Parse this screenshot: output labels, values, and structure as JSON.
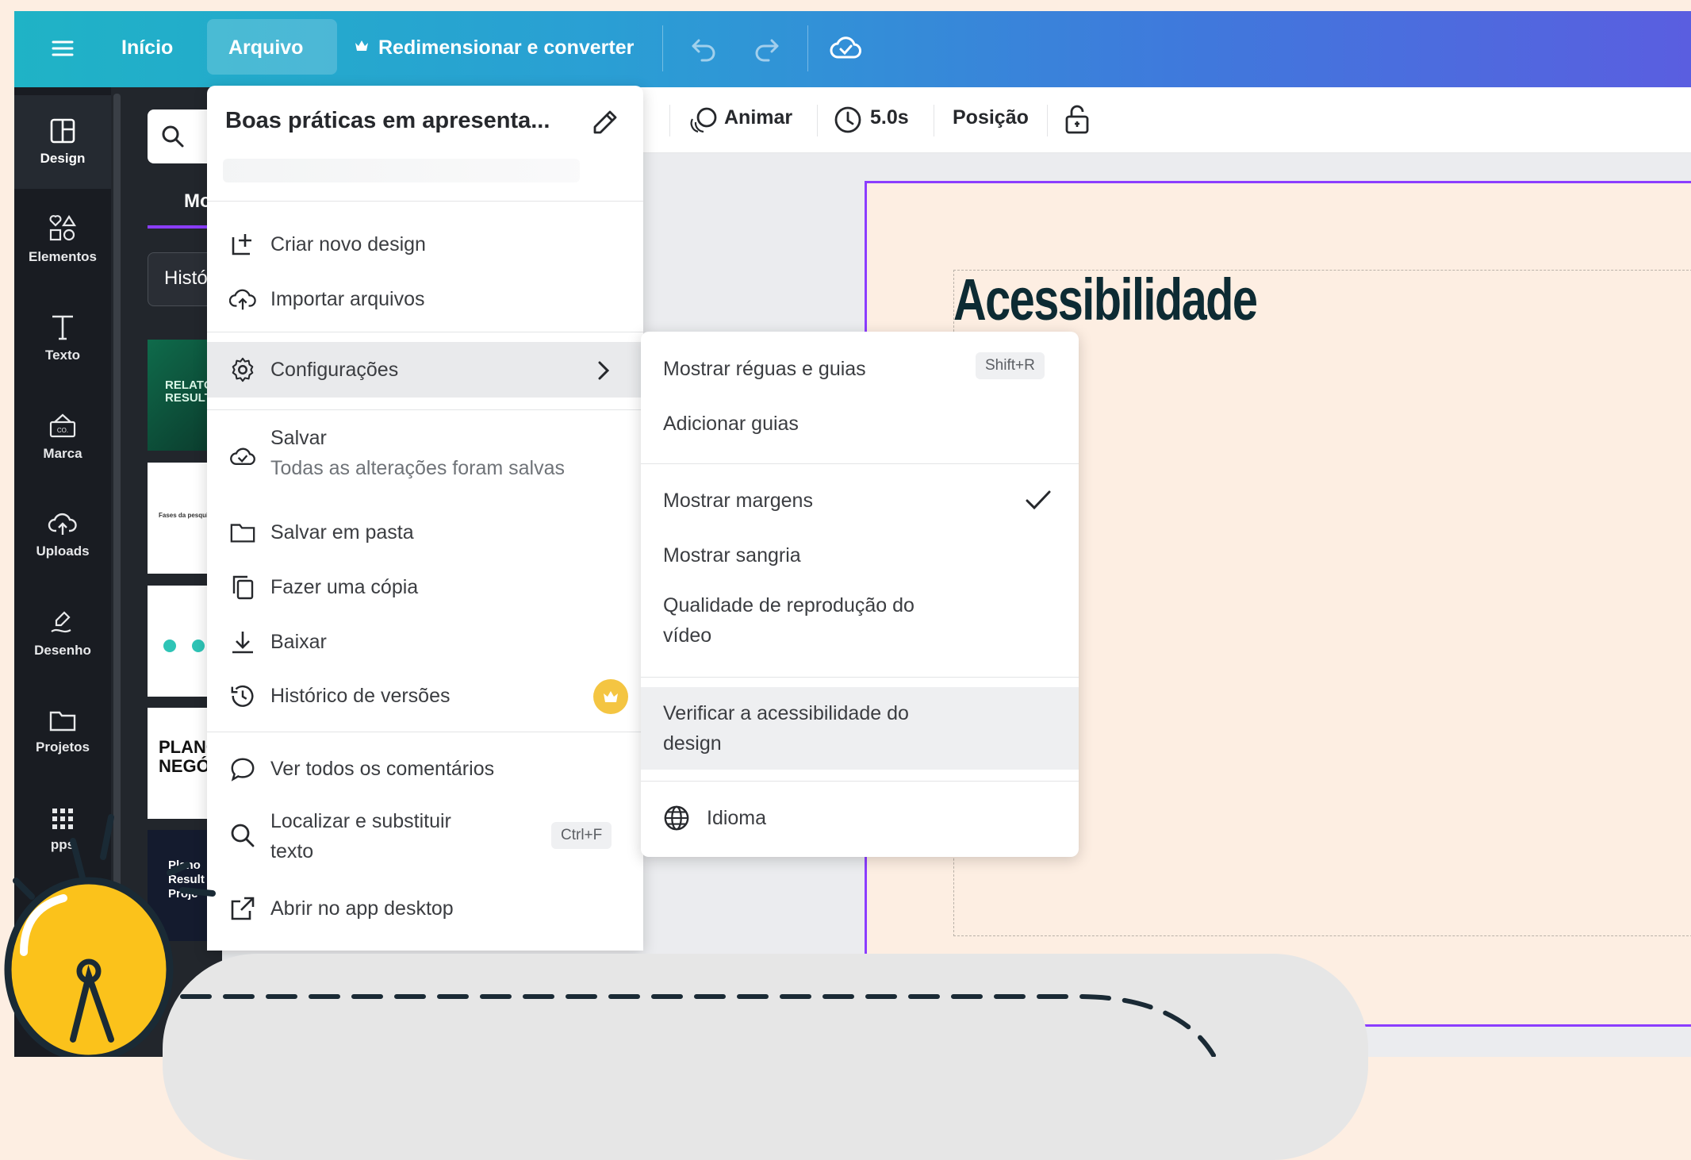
{
  "topbar": {
    "menu_icon": "hamburger-icon",
    "home_label": "Início",
    "file_label": "Arquivo",
    "resize_label": "Redimensionar e converter",
    "undo_icon": "undo-icon",
    "redo_icon": "redo-icon",
    "saved_icon": "cloud-check-icon"
  },
  "rail": {
    "items": [
      {
        "label": "Design",
        "icon": "layout-icon"
      },
      {
        "label": "Elementos",
        "icon": "shapes-icon"
      },
      {
        "label": "Texto",
        "icon": "text-icon"
      },
      {
        "label": "Marca",
        "icon": "brand-icon"
      },
      {
        "label": "Uploads",
        "icon": "cloud-upload-icon"
      },
      {
        "label": "Desenho",
        "icon": "draw-icon"
      },
      {
        "label": "Projetos",
        "icon": "folder-icon"
      },
      {
        "label": "pps",
        "icon": "apps-icon"
      }
    ]
  },
  "panel": {
    "tab_partial": "Mo",
    "history_partial": "Histó",
    "thumbs": [
      "RELATÓ RESULT",
      "Fases da pesquisa",
      "",
      "PLANO NEGÓCI",
      "Plano Result Proje"
    ]
  },
  "toolbar": {
    "animate_label": "Animar",
    "duration_label": "5.0s",
    "position_label": "Posição",
    "lock_icon": "lock-icon"
  },
  "canvas": {
    "title": "Acessibilidade",
    "accent_color": "#8b3dff"
  },
  "file_menu": {
    "design_title": "Boas práticas em apresenta...",
    "items": {
      "new_design": "Criar novo design",
      "import": "Importar arquivos",
      "settings": "Configurações",
      "save": "Salvar",
      "save_status": "Todas as alterações foram salvas",
      "save_folder": "Salvar em pasta",
      "copy": "Fazer uma cópia",
      "download": "Baixar",
      "history": "Histórico de versões",
      "comments": "Ver todos os comentários",
      "find_replace": "Localizar e substituir texto",
      "find_shortcut": "Ctrl+F",
      "desktop_app": "Abrir no app desktop"
    }
  },
  "settings_menu": {
    "rulers": "Mostrar réguas e guias",
    "rulers_shortcut": "Shift+R",
    "add_guides": "Adicionar guias",
    "margins": "Mostrar margens",
    "margins_checked": true,
    "bleed": "Mostrar sangria",
    "video_quality": "Qualidade de reprodução do vídeo",
    "accessibility": "Verificar a acessibilidade do design",
    "language": "Idioma"
  }
}
